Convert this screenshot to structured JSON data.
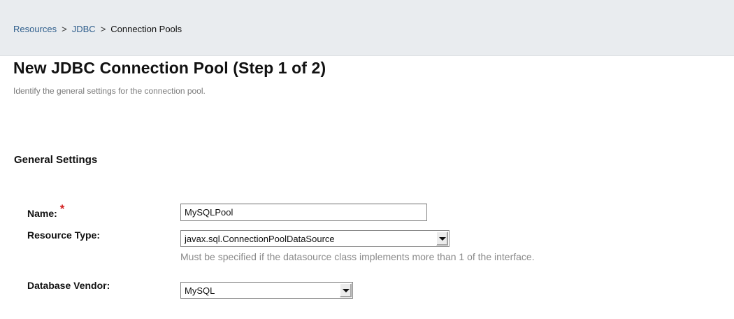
{
  "breadcrumb": {
    "items": [
      "Resources",
      "JDBC",
      "Connection Pools"
    ],
    "separator": ">"
  },
  "page": {
    "title": "New JDBC Connection Pool (Step 1 of 2)",
    "help": "Identify the general settings for the connection pool."
  },
  "section": {
    "title": "General Settings"
  },
  "form": {
    "name": {
      "label": "Name:",
      "required_marker": "*",
      "value": "MySQLPool"
    },
    "resource_type": {
      "label": "Resource Type:",
      "value": "javax.sql.ConnectionPoolDataSource",
      "help": "Must be specified if the datasource class implements more than 1 of the interface."
    },
    "database_vendor": {
      "label": "Database Vendor:",
      "value": "MySQL"
    }
  },
  "colors": {
    "breadcrumb_bg": "#e9ecef",
    "link": "#2f5e8c",
    "required": "#d22020",
    "help_text": "#8a8a8a"
  }
}
